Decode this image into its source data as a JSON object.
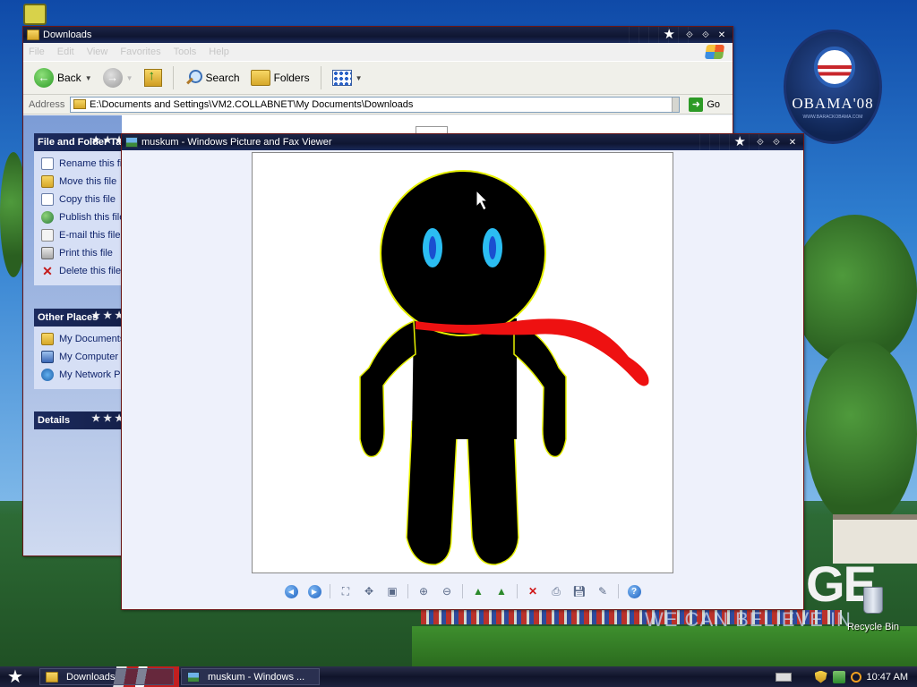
{
  "colors": {
    "accent": "#0f1632",
    "title_border": "#6a1616",
    "scarf": "#ee1111",
    "eye": "#2bbdf2"
  },
  "desktop": {
    "logo_text": "OBAMA'08",
    "logo_url": "WWW.BARACKOBAMA.COM",
    "slogan_big": "GE",
    "slogan_small": "WE CAN BELIEVE IN",
    "recycle_bin_label": "Recycle Bin"
  },
  "downloads_window": {
    "title": "Downloads",
    "menu": [
      "File",
      "Edit",
      "View",
      "Favorites",
      "Tools",
      "Help"
    ],
    "toolbar": {
      "back": "Back",
      "search": "Search",
      "folders": "Folders"
    },
    "address": {
      "label": "Address",
      "path": "E:\\Documents and Settings\\VM2.COLLABNET\\My Documents\\Downloads",
      "go": "Go"
    },
    "file_tasks": {
      "header": "File and Folder Tasks",
      "items": [
        "Rename this file",
        "Move this file",
        "Copy this file",
        "Publish this file to the Web",
        "E-mail this file",
        "Print this file",
        "Delete this file"
      ]
    },
    "other_places": {
      "header": "Other Places",
      "items": [
        "My Documents",
        "My Computer",
        "My Network Places"
      ]
    },
    "details": {
      "header": "Details"
    }
  },
  "viewer_window": {
    "title": "muskum - Windows Picture and Fax Viewer",
    "toolbar": {
      "previous": "Previous Image",
      "next": "Next Image",
      "best_fit": "Best Fit",
      "actual_size": "Actual Size",
      "slideshow": "Start Slide Show",
      "zoom_in": "Zoom In",
      "zoom_out": "Zoom Out",
      "rotate_cw": "Rotate Clockwise",
      "rotate_ccw": "Rotate Counterclockwise",
      "delete": "Delete",
      "print": "Print",
      "save": "Copy To",
      "edit": "Close this program and open the image for editing",
      "help": "Help"
    }
  },
  "taskbar": {
    "tasks": [
      "Downloads",
      "muskum - Windows ..."
    ],
    "clock": "10:47 AM"
  }
}
